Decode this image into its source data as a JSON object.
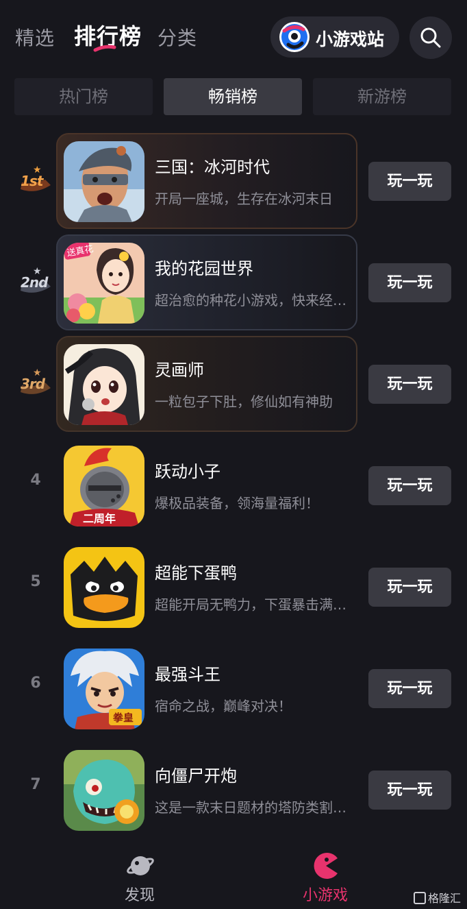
{
  "nav": {
    "tabs": [
      {
        "label": "精选",
        "active": false
      },
      {
        "label": "排行榜",
        "active": true
      },
      {
        "label": "分类",
        "active": false
      }
    ],
    "minigame_station": "小游戏站",
    "search_icon": "search-icon"
  },
  "segments": [
    {
      "label": "热门榜",
      "active": false
    },
    {
      "label": "畅销榜",
      "active": true
    },
    {
      "label": "新游榜",
      "active": false
    }
  ],
  "play_label": "玩一玩",
  "rows": [
    {
      "rank": "1",
      "badge": "1st",
      "title": "三国：冰河时代",
      "desc": "开局一座城，生存在冰河末日"
    },
    {
      "rank": "2",
      "badge": "2nd",
      "title": "我的花园世界",
      "desc": "超治愈的种花小游戏，快来经…",
      "icon_tag": "送真花"
    },
    {
      "rank": "3",
      "badge": "3rd",
      "title": "灵画师",
      "desc": "一粒包子下肚，修仙如有神助"
    },
    {
      "rank": "4",
      "title": "跃动小子",
      "desc": "爆极品装备，领海量福利！",
      "icon_tag": "二周年"
    },
    {
      "rank": "5",
      "title": "超能下蛋鸭",
      "desc": "超能开局无鸭力，下蛋暴击满…"
    },
    {
      "rank": "6",
      "title": "最强斗王",
      "desc": "宿命之战，巅峰对决！",
      "icon_tag": "拳皇"
    },
    {
      "rank": "7",
      "title": "向僵尸开炮",
      "desc": "这是一款末日题材的塔防类割…"
    }
  ],
  "bottom_bar": [
    {
      "label": "发现",
      "active": false,
      "icon": "planet-icon"
    },
    {
      "label": "小游戏",
      "active": true,
      "icon": "pacman-icon"
    }
  ],
  "watermark": "格隆汇",
  "colors": {
    "background": "#17171d",
    "accent_pink": "#e8336d",
    "button_bg": "#3a3a42",
    "gold": "#e08a3c",
    "silver": "#c9ccd6",
    "bronze": "#d89a5a"
  }
}
